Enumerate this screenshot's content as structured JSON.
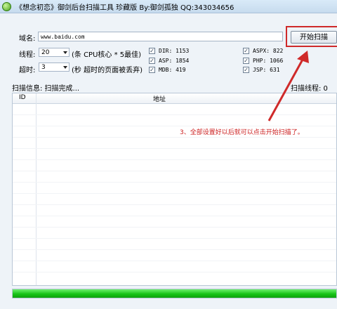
{
  "window": {
    "title": "《想念初恋》御剑后台扫描工具 珍藏版 By:御剑孤独 QQ:343034656"
  },
  "domain": {
    "label": "域名:",
    "value": "www.baidu.com"
  },
  "scan_button": {
    "label": "开始扫描"
  },
  "threads": {
    "label": "线程:",
    "value": "20",
    "hint": "(条 CPU核心 * 5最佳)"
  },
  "timeout": {
    "label": "超时:",
    "value": "3",
    "hint": "(秒 超时的页面被丢弃)"
  },
  "checkboxes": [
    {
      "label": "DIR: 1153",
      "checked": true
    },
    {
      "label": "ASP: 1854",
      "checked": true
    },
    {
      "label": "MDB: 419",
      "checked": true
    },
    {
      "label": "ASPX: 822",
      "checked": true
    },
    {
      "label": "PHP: 1066",
      "checked": true
    },
    {
      "label": "JSP: 631",
      "checked": true
    }
  ],
  "status": {
    "info": "扫描信息: 扫描完成...",
    "threads_text": "扫描线程: 0"
  },
  "table": {
    "columns": [
      "ID",
      "地址"
    ]
  },
  "annotation": "3、全部设置好以后就可以点击开始扫描了。",
  "progress": {
    "fraction": 1.0
  },
  "colors": {
    "annotation": "#cc1f1f",
    "progress": "#18c418",
    "arrow": "#cf2a2a"
  }
}
